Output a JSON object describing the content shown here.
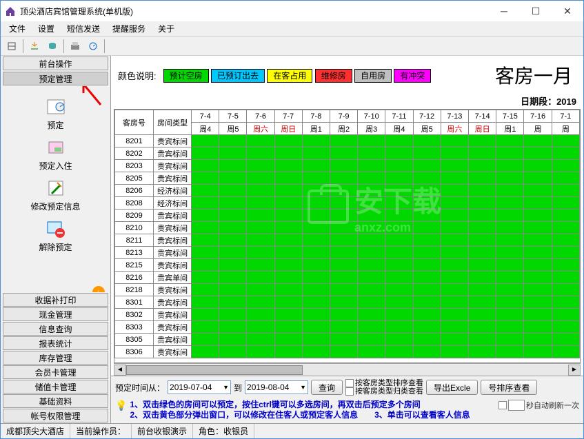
{
  "window": {
    "title": "顶尖酒店宾馆管理系统(单机版)"
  },
  "menus": [
    "文件",
    "设置",
    "短信发送",
    "提醒服务",
    "关于"
  ],
  "sidebar": {
    "top_btn": "前台操作",
    "active_btn": "预定管理",
    "items": [
      {
        "label": "预定"
      },
      {
        "label": "预定入住"
      },
      {
        "label": "修改预定信息"
      },
      {
        "label": "解除预定"
      }
    ],
    "bottom_btns": [
      "收据补打印",
      "现金管理",
      "信息查询",
      "报表统计",
      "库存管理",
      "会员卡管理",
      "储值卡管理",
      "基础资料",
      "帐号权限管理"
    ]
  },
  "legend": {
    "label": "颜色说明:",
    "chips": [
      {
        "text": "预计空房",
        "bg": "#00d800"
      },
      {
        "text": "已预订出去",
        "bg": "#00c8ff"
      },
      {
        "text": "在客占用",
        "bg": "#ffff00"
      },
      {
        "text": "维修房",
        "bg": "#ff3030"
      },
      {
        "text": "自用房",
        "bg": "#c0c0c0"
      },
      {
        "text": "有冲突",
        "bg": "#ff00ff"
      }
    ]
  },
  "big_title": "客房一月",
  "date_range_label": "日期段：2019",
  "grid": {
    "headers": {
      "room_no": "客房号",
      "room_type": "房间类型"
    },
    "dates": [
      {
        "md": "7-4",
        "wd": "周4",
        "red": false
      },
      {
        "md": "7-5",
        "wd": "周5",
        "red": false
      },
      {
        "md": "7-6",
        "wd": "周六",
        "red": true
      },
      {
        "md": "7-7",
        "wd": "周日",
        "red": true
      },
      {
        "md": "7-8",
        "wd": "周1",
        "red": false
      },
      {
        "md": "7-9",
        "wd": "周2",
        "red": false
      },
      {
        "md": "7-10",
        "wd": "周3",
        "red": false
      },
      {
        "md": "7-11",
        "wd": "周4",
        "red": false
      },
      {
        "md": "7-12",
        "wd": "周5",
        "red": false
      },
      {
        "md": "7-13",
        "wd": "周六",
        "red": true
      },
      {
        "md": "7-14",
        "wd": "周日",
        "red": true
      },
      {
        "md": "7-15",
        "wd": "周1",
        "red": false
      },
      {
        "md": "7-16",
        "wd": "周",
        "red": false
      },
      {
        "md": "7-1",
        "wd": "周",
        "red": false
      }
    ],
    "rows": [
      {
        "no": "8201",
        "type": "贵宾标间"
      },
      {
        "no": "8202",
        "type": "贵宾标间"
      },
      {
        "no": "8203",
        "type": "贵宾标间"
      },
      {
        "no": "8205",
        "type": "贵宾标间"
      },
      {
        "no": "8206",
        "type": "经济标间"
      },
      {
        "no": "8208",
        "type": "经济标间"
      },
      {
        "no": "8209",
        "type": "贵宾标间"
      },
      {
        "no": "8210",
        "type": "贵宾标间"
      },
      {
        "no": "8211",
        "type": "贵宾标间"
      },
      {
        "no": "8213",
        "type": "贵宾标间"
      },
      {
        "no": "8215",
        "type": "贵宾标间"
      },
      {
        "no": "8216",
        "type": "贵宾单间"
      },
      {
        "no": "8218",
        "type": "贵宾标间"
      },
      {
        "no": "8301",
        "type": "贵宾标间"
      },
      {
        "no": "8302",
        "type": "贵宾标间"
      },
      {
        "no": "8303",
        "type": "贵宾标间"
      },
      {
        "no": "8305",
        "type": "贵宾标间"
      },
      {
        "no": "8306",
        "type": "贵宾标间"
      }
    ]
  },
  "query": {
    "label_from": "预定时间从：",
    "date_from": "2019-07-04",
    "label_to": "到",
    "date_to": "2019-08-04",
    "btn_query": "查询",
    "chk1": "按客房类型排序查看",
    "chk2": "按客房类型归类查看",
    "btn_export": "导出Excle",
    "btn_sort": "号排序查看"
  },
  "tips": {
    "line1": "1、双击绿色的房间可以预定，按住ctrl键可以多选房间，再双击后预定多个房间",
    "line2": "2、双击黄色部分弹出窗口，可以修改在住客人或预定客人信息　　3、单击可以查看客人信息",
    "refresh": "秒自动刷新一次"
  },
  "status": {
    "hotel": "成都顶尖大酒店",
    "op_label": "当前操作员：",
    "op_value": "前台收银演示",
    "role_label": "角色：",
    "role_value": "收银员"
  },
  "watermark": {
    "text": "安下载",
    "sub": "anxz.com"
  }
}
